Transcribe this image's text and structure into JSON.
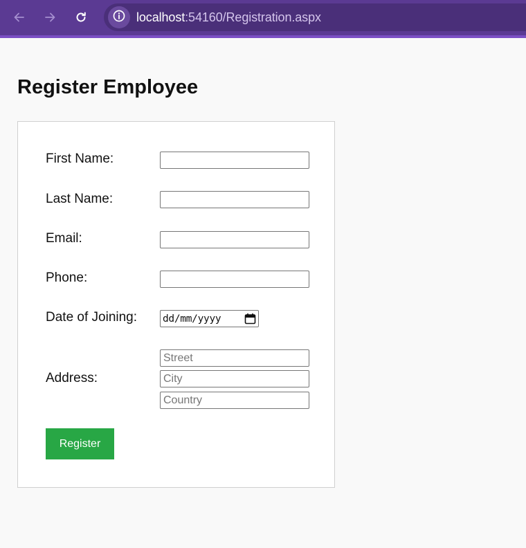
{
  "browser": {
    "url_host": "localhost",
    "url_rest": ":54160/Registration.aspx",
    "back_icon": "arrow-left-icon",
    "forward_icon": "arrow-right-icon",
    "reload_icon": "reload-icon",
    "site_info_icon": "info-icon"
  },
  "page": {
    "title": "Register Employee"
  },
  "form": {
    "first_name_label": "First Name:",
    "first_name_value": "",
    "last_name_label": "Last Name:",
    "last_name_value": "",
    "email_label": "Email:",
    "email_value": "",
    "phone_label": "Phone:",
    "phone_value": "",
    "doj_label": "Date of Joining:",
    "doj_placeholder": "dd/mm/yyyy",
    "address_label": "Address:",
    "street_placeholder": "Street",
    "city_placeholder": "City",
    "country_placeholder": "Country",
    "register_label": "Register"
  },
  "colors": {
    "toolbar": "#5b3a93",
    "button": "#28a745"
  }
}
